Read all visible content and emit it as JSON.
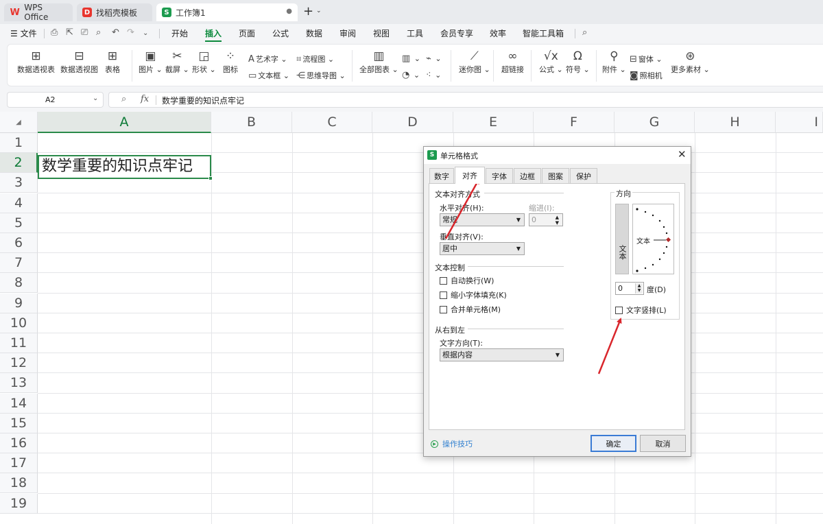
{
  "tabs": {
    "wps": "WPS Office",
    "template": "找稻壳模板",
    "workbook": "工作簿1"
  },
  "menu": {
    "file": "文件",
    "items": [
      "开始",
      "插入",
      "页面",
      "公式",
      "数据",
      "审阅",
      "视图",
      "工具",
      "会员专享",
      "效率",
      "智能工具箱"
    ],
    "active": "插入"
  },
  "ribbon": {
    "pivot_table": "数据透视表",
    "pivot_chart": "数据透视图",
    "table": "表格",
    "picture": "图片",
    "screenshot": "截屏",
    "shape": "形状",
    "icon": "图标",
    "art_text": "艺术字",
    "text_box": "文本框",
    "flowchart": "流程图",
    "mindmap": "思维导图",
    "all_charts": "全部图表",
    "sparkline": "迷你图",
    "hyperlink": "超链接",
    "formula": "公式",
    "symbol": "符号",
    "attachment": "附件",
    "window": "窗体",
    "camera": "照相机",
    "more": "更多素材"
  },
  "formula_bar": {
    "cell_ref": "A2",
    "fx": "fx",
    "content": "数学重要的知识点牢记"
  },
  "grid": {
    "columns": [
      "A",
      "B",
      "C",
      "D",
      "E",
      "F",
      "G",
      "H",
      "I"
    ],
    "rows": [
      "1",
      "2",
      "3",
      "4",
      "5",
      "6",
      "7",
      "8",
      "9",
      "10",
      "11",
      "12",
      "13",
      "14",
      "15",
      "16",
      "17",
      "18",
      "19"
    ],
    "cell_a2": "数学重要的知识点牢记"
  },
  "dialog": {
    "title": "单元格格式",
    "tabs": [
      "数字",
      "对齐",
      "字体",
      "边框",
      "图案",
      "保护"
    ],
    "active_tab": "对齐",
    "text_alignment": "文本对齐方式",
    "horizontal_label": "水平对齐(H):",
    "horizontal_value": "常规",
    "indent_label": "缩进(I):",
    "indent_value": "0",
    "vertical_label": "垂直对齐(V):",
    "vertical_value": "居中",
    "text_control": "文本控制",
    "wrap_text": "自动换行(W)",
    "shrink_to_fit": "缩小字体填充(K)",
    "merge_cells": "合并单元格(M)",
    "rtl_group": "从右到左",
    "text_direction_label": "文字方向(T):",
    "text_direction_value": "根据内容",
    "orientation": "方向",
    "vertical_text": "文本",
    "dial_text": "文本",
    "degree_value": "0",
    "degree_label": "度(D)",
    "vertical_stack": "文字竖排(L)",
    "tips": "操作技巧",
    "ok": "确定",
    "cancel": "取消"
  },
  "colors": {
    "accent": "#0c8a3d",
    "wps_red": "#e8352e",
    "annotation_arrow": "#d9262c"
  }
}
